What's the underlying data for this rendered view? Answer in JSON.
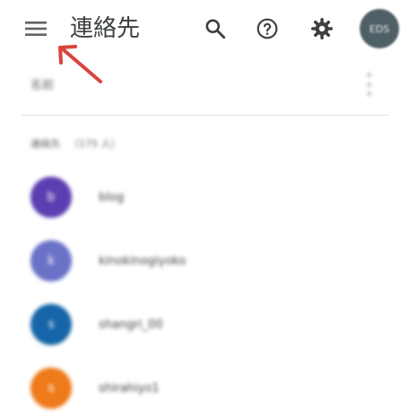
{
  "appbar": {
    "title": "連絡先",
    "menu_icon": "hamburger-menu-icon",
    "search_icon": "search-icon",
    "help_icon": "help-icon",
    "settings_icon": "gear-icon",
    "account_initials": "EDS"
  },
  "list_header": {
    "label": "名前"
  },
  "section": {
    "label": "連絡先",
    "count": "（175 人）"
  },
  "contacts": [
    {
      "initial": "b",
      "name": "blog",
      "color": "#5b3fb2"
    },
    {
      "initial": "k",
      "name": "kinokinogiyoko",
      "color": "#6a72c8"
    },
    {
      "initial": "s",
      "name": "shangri_00",
      "color": "#1565a8"
    },
    {
      "initial": "s",
      "name": "shirahiyo1",
      "color": "#ee7a1a"
    }
  ],
  "colors": {
    "annotation_arrow": "#d9443b"
  }
}
